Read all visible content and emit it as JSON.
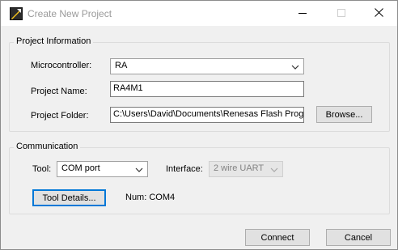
{
  "window": {
    "title": "Create New Project",
    "icon": "renesas-flash-programmer-icon",
    "controls": {
      "minimize": "minimize-icon",
      "maximize": "maximize-icon",
      "close": "close-icon"
    }
  },
  "project_info": {
    "legend": "Project Information",
    "microcontroller_label": "Microcontroller:",
    "microcontroller_value": "RA",
    "project_name_label": "Project Name:",
    "project_name_value": "RA4M1",
    "project_folder_label": "Project Folder:",
    "project_folder_value": "C:\\Users\\David\\Documents\\Renesas Flash Prog",
    "browse_label": "Browse..."
  },
  "communication": {
    "legend": "Communication",
    "tool_label": "Tool:",
    "tool_value": "COM port",
    "interface_label": "Interface:",
    "interface_value": "2 wire UART",
    "tool_details_label": "Tool Details...",
    "num_text": "Num: COM4"
  },
  "footer": {
    "connect_label": "Connect",
    "cancel_label": "Cancel"
  },
  "colors": {
    "focus_border": "#0078d7",
    "title_text": "#9a9a9a",
    "disabled_text": "#838383"
  }
}
